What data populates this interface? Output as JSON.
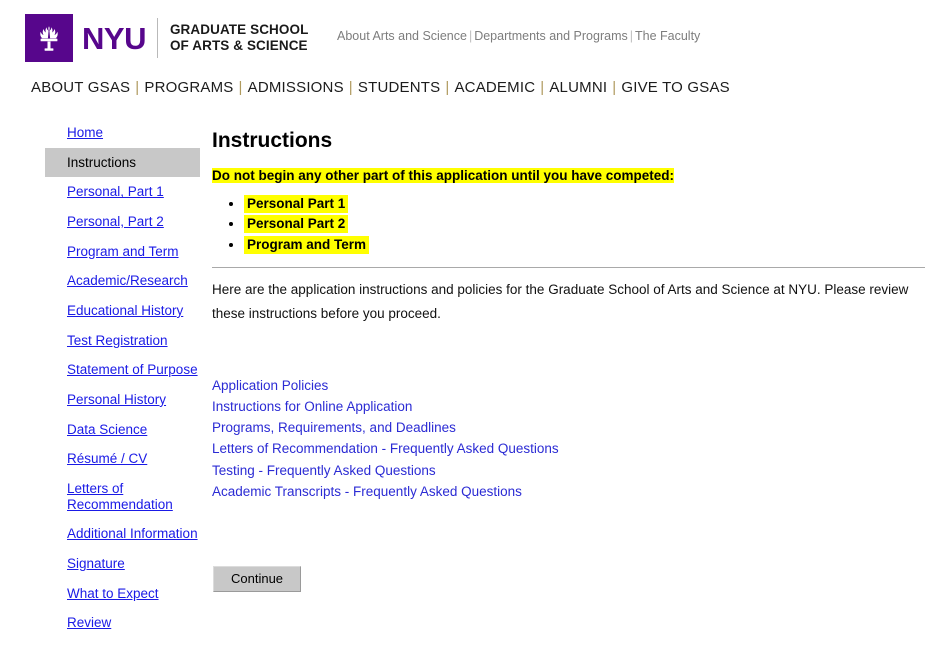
{
  "header": {
    "logo": {
      "icon": "nyu-torch-icon",
      "wordmark": "NYU",
      "school_line1": "GRADUATE SCHOOL",
      "school_line2": "OF ARTS & SCIENCE",
      "brand_color": "#57068c"
    },
    "utility_links": [
      "About Arts and Science",
      "Departments and Programs",
      "The Faculty"
    ],
    "utility_separator": "|",
    "nav_items": [
      "ABOUT GSAS",
      "PROGRAMS",
      "ADMISSIONS",
      "STUDENTS",
      "ACADEMIC",
      "ALUMNI",
      "GIVE TO GSAS"
    ],
    "nav_separator": "|"
  },
  "sidebar": {
    "items": [
      {
        "label": "Home",
        "active": false
      },
      {
        "label": "Instructions",
        "active": true
      },
      {
        "label": "Personal, Part 1",
        "active": false
      },
      {
        "label": "Personal, Part 2",
        "active": false
      },
      {
        "label": "Program and Term",
        "active": false
      },
      {
        "label": "Academic/Research",
        "active": false
      },
      {
        "label": "Educational History",
        "active": false
      },
      {
        "label": "Test Registration",
        "active": false
      },
      {
        "label": "Statement of Purpose",
        "active": false
      },
      {
        "label": "Personal History",
        "active": false
      },
      {
        "label": "Data Science",
        "active": false
      },
      {
        "label": "Résumé / CV",
        "active": false
      },
      {
        "label": "Letters of Recommendation",
        "active": false
      },
      {
        "label": "Additional Information",
        "active": false
      },
      {
        "label": "Signature",
        "active": false
      },
      {
        "label": "What to Expect",
        "active": false
      },
      {
        "label": "Review",
        "active": false
      }
    ],
    "active_background": "#c8c8c8",
    "link_color": "#1a1ae6"
  },
  "main": {
    "title": "Instructions",
    "warning": "Do not begin any other part of this application until you have competed:",
    "highlight_color": "#ffff00",
    "required_items": [
      "Personal Part 1",
      "Personal Part 2",
      "Program and Term"
    ],
    "intro_paragraph": "Here are the application instructions and policies for the Graduate School of Arts and Science at NYU. Please review these instructions before you proceed.",
    "resource_links": [
      "Application Policies",
      "Instructions for Online Application",
      "Programs, Requirements, and Deadlines",
      "Letters of Recommendation - Frequently Asked Questions",
      "Testing  - Frequently Asked Questions",
      "Academic Transcripts - Frequently Asked Questions"
    ],
    "resource_link_color": "#2b2bd4",
    "continue_label": "Continue"
  }
}
